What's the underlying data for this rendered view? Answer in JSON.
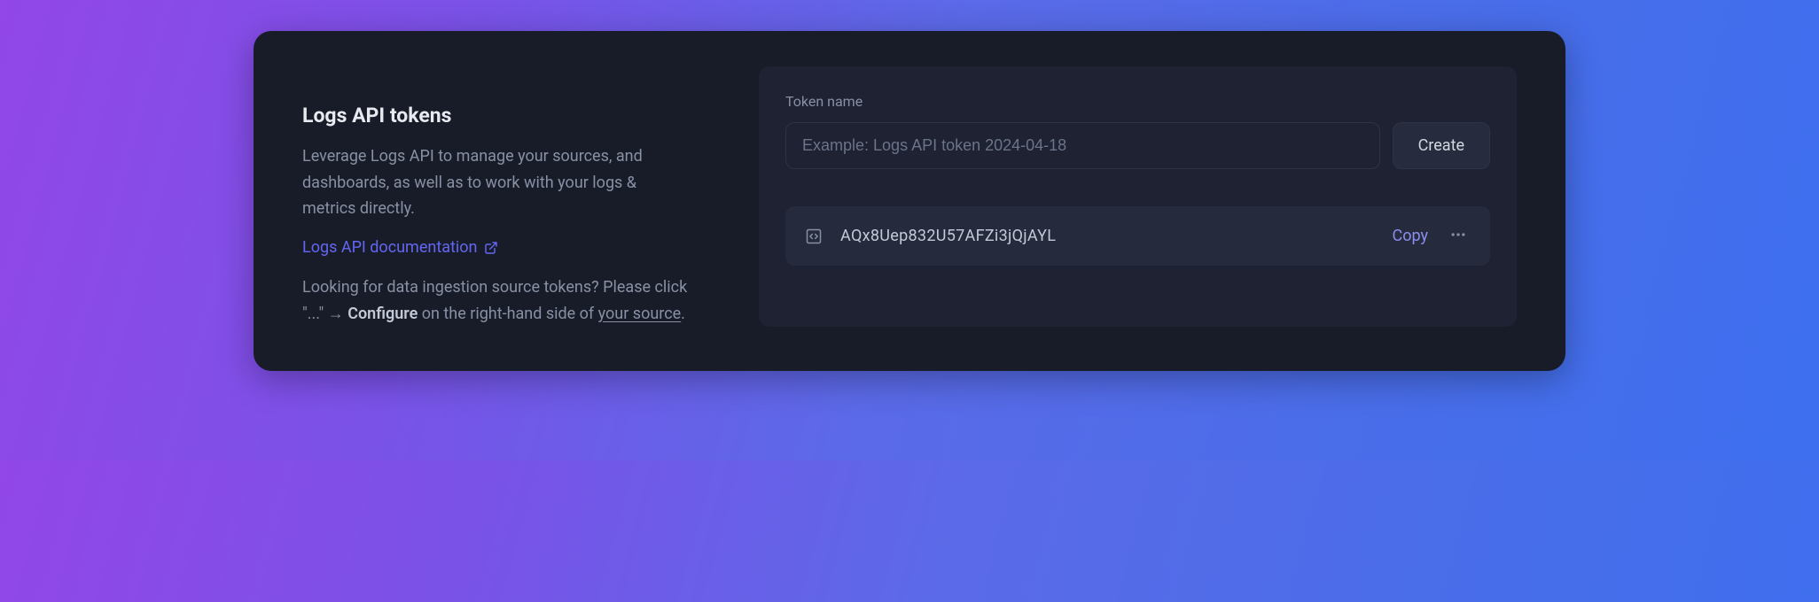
{
  "left": {
    "title": "Logs API tokens",
    "description": "Leverage Logs API to manage your sources, and dashboards, as well as to work with your logs & metrics directly.",
    "doc_link_label": "Logs API documentation",
    "hint_part1": "Looking for data ingestion source tokens? Please click \"...\" → ",
    "hint_strong": "Configure",
    "hint_part2": " on the right-hand side of ",
    "hint_underlined": "your source",
    "hint_part3": "."
  },
  "form": {
    "label": "Token name",
    "placeholder": "Example: Logs API token 2024-04-18",
    "create_label": "Create"
  },
  "token": {
    "value": "AQx8Uep832U57AFZi3jQjAYL",
    "copy_label": "Copy"
  }
}
